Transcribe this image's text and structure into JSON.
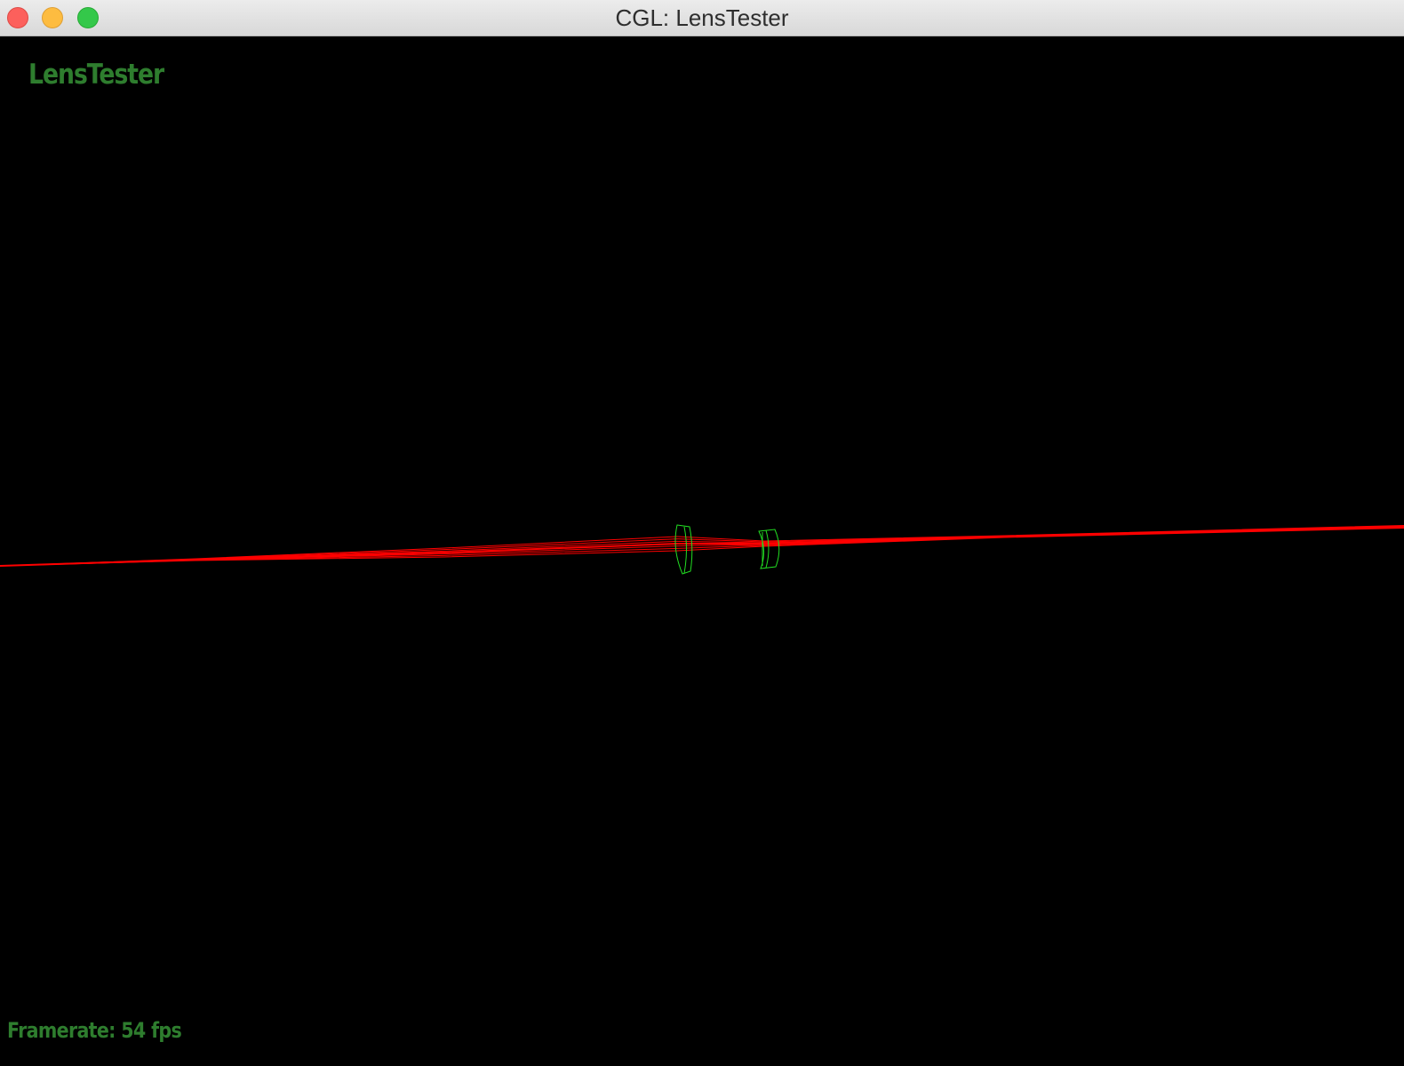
{
  "window": {
    "title": "CGL: LensTester",
    "controls": {
      "close": "close-button",
      "minimize": "minimize-button",
      "zoom": "zoom-button"
    }
  },
  "overlay": {
    "app_name": "LensTester",
    "framerate_text": "Framerate: 54 fps",
    "text_color": "#2e7d2e"
  },
  "scene": {
    "background": "#000000",
    "ray_color": "#ff0000",
    "lens_color": "#22dd22",
    "ray_count": 7,
    "lens_count": 2
  }
}
